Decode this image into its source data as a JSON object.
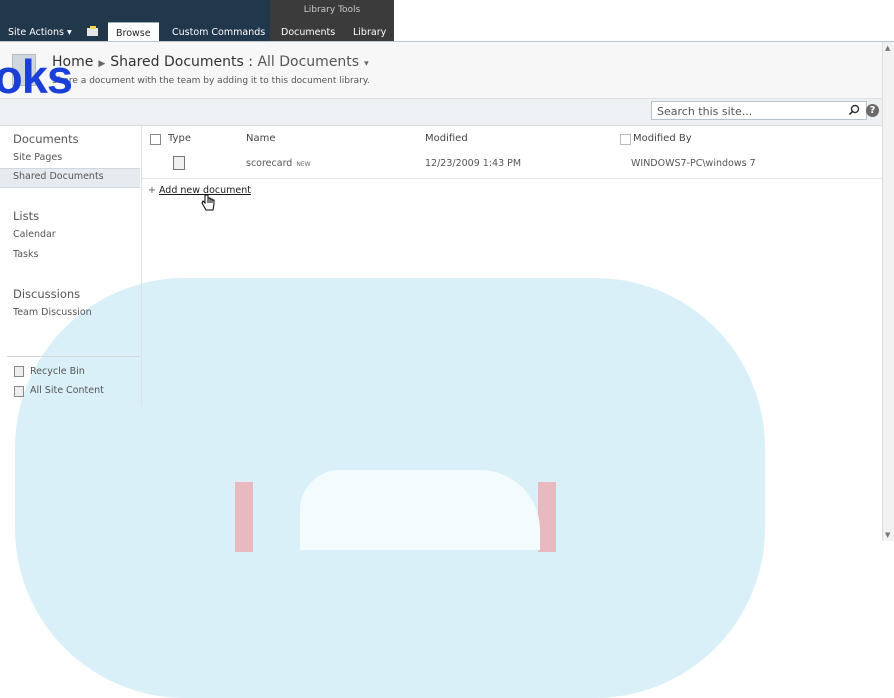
{
  "ribbon": {
    "site_actions": "Site Actions ▾",
    "browse_tab": "Browse",
    "custom_commands_tab": "Custom Commands",
    "library_tools_title": "Library Tools",
    "documents_tab": "Documents",
    "library_tab": "Library"
  },
  "title_area": {
    "home": "Home",
    "section": "Shared Documents",
    "view": "All Documents",
    "description": "Share a document with the team by adding it to this document library.",
    "overlay_text": "oks"
  },
  "search": {
    "placeholder": "Search this site..."
  },
  "leftnav": {
    "documents_head": "Documents",
    "site_pages": "Site Pages",
    "shared_documents": "Shared Documents",
    "lists_head": "Lists",
    "calendar": "Calendar",
    "tasks": "Tasks",
    "discussions_head": "Discussions",
    "team_discussion": "Team Discussion",
    "recycle_bin": "Recycle Bin",
    "all_site_content": "All Site Content"
  },
  "list": {
    "columns": {
      "type": "Type",
      "name": "Name",
      "modified": "Modified",
      "modified_by": "Modified By"
    },
    "rows": [
      {
        "name": "scorecard",
        "badge": "NEW",
        "modified": "12/23/2009 1:43 PM",
        "modified_by": "WINDOWS7-PC\\windows 7"
      }
    ],
    "add_new": "Add new document"
  },
  "colors": {
    "ribbon_dark": "#21374c",
    "context_group": "#3b3b3b",
    "overlay_text": "#1a3fd8",
    "background_art": "#d9f0f8"
  }
}
